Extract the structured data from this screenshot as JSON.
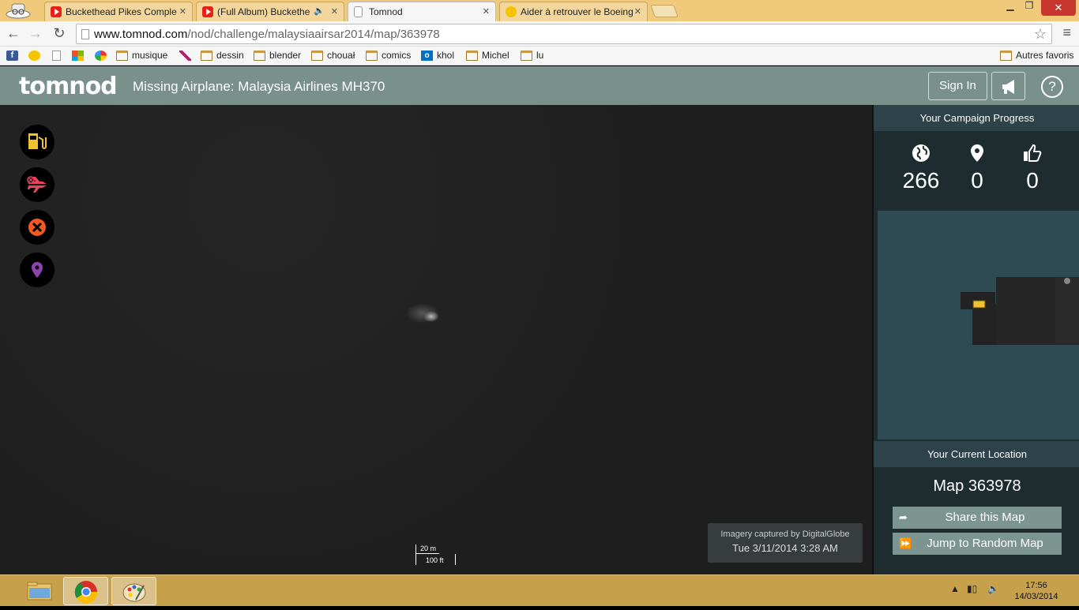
{
  "browser": {
    "tabs": [
      {
        "title": "Buckethead Pikes Comple",
        "icon": "youtube-icon"
      },
      {
        "title": "(Full Album) Buckethe",
        "icon": "youtube-icon"
      },
      {
        "title": "Tomnod",
        "icon": "page-icon"
      },
      {
        "title": "Aider à retrouver le Boeing",
        "icon": "face-icon"
      }
    ],
    "close_glyph": "✕",
    "address": {
      "domain": "www.tomnod.com",
      "path": "/nod/challenge/malaysiaairsar2014/map/363978"
    },
    "bookmarks": [
      {
        "label": "",
        "icon": "facebook-icon"
      },
      {
        "label": "",
        "icon": "face-icon"
      },
      {
        "label": "",
        "icon": "page-icon"
      },
      {
        "label": "",
        "icon": "windows-icon"
      },
      {
        "label": "",
        "icon": "ring-icon"
      },
      {
        "label": "musique",
        "icon": "folder-icon"
      },
      {
        "label": "",
        "icon": "feather-icon"
      },
      {
        "label": "dessin",
        "icon": "folder-icon"
      },
      {
        "label": "blender",
        "icon": "folder-icon"
      },
      {
        "label": "chouał",
        "icon": "folder-icon"
      },
      {
        "label": "comics",
        "icon": "folder-icon"
      },
      {
        "label": "khol",
        "icon": "outlook-icon"
      },
      {
        "label": "Michel",
        "icon": "folder-icon"
      },
      {
        "label": "lu",
        "icon": "folder-icon"
      }
    ],
    "other_bookmarks": "Autres favoris"
  },
  "header": {
    "logo": "tomnod",
    "title": "Missing Airplane: Malaysia Airlines MH370",
    "signin_label": "Sign In",
    "help_label": "?"
  },
  "tools": [
    {
      "name": "fuel-tag",
      "color": "#f2c12e"
    },
    {
      "name": "airplane-tag",
      "color": "#e8455c"
    },
    {
      "name": "close-tag",
      "color": "#f05a22"
    },
    {
      "name": "location-tag",
      "color": "#8e44ad"
    }
  ],
  "map": {
    "scale_top": "20 m",
    "scale_bottom": "100 ft",
    "imagery_line1": "Imagery captured by DigitalGlobe",
    "imagery_line2": "Tue 3/11/2014 3:28 AM"
  },
  "panel": {
    "progress_title": "Your Campaign Progress",
    "stats": [
      {
        "icon": "globe-icon",
        "value": "266"
      },
      {
        "icon": "pin-icon",
        "value": "0"
      },
      {
        "icon": "thumbs-up-icon",
        "value": "0"
      }
    ],
    "location_title": "Your Current Location",
    "location_value": "Map 363978",
    "share_label": "Share this Map",
    "random_label": "Jump to Random Map"
  },
  "taskbar": {
    "time": "17:56",
    "date": "14/03/2014"
  }
}
